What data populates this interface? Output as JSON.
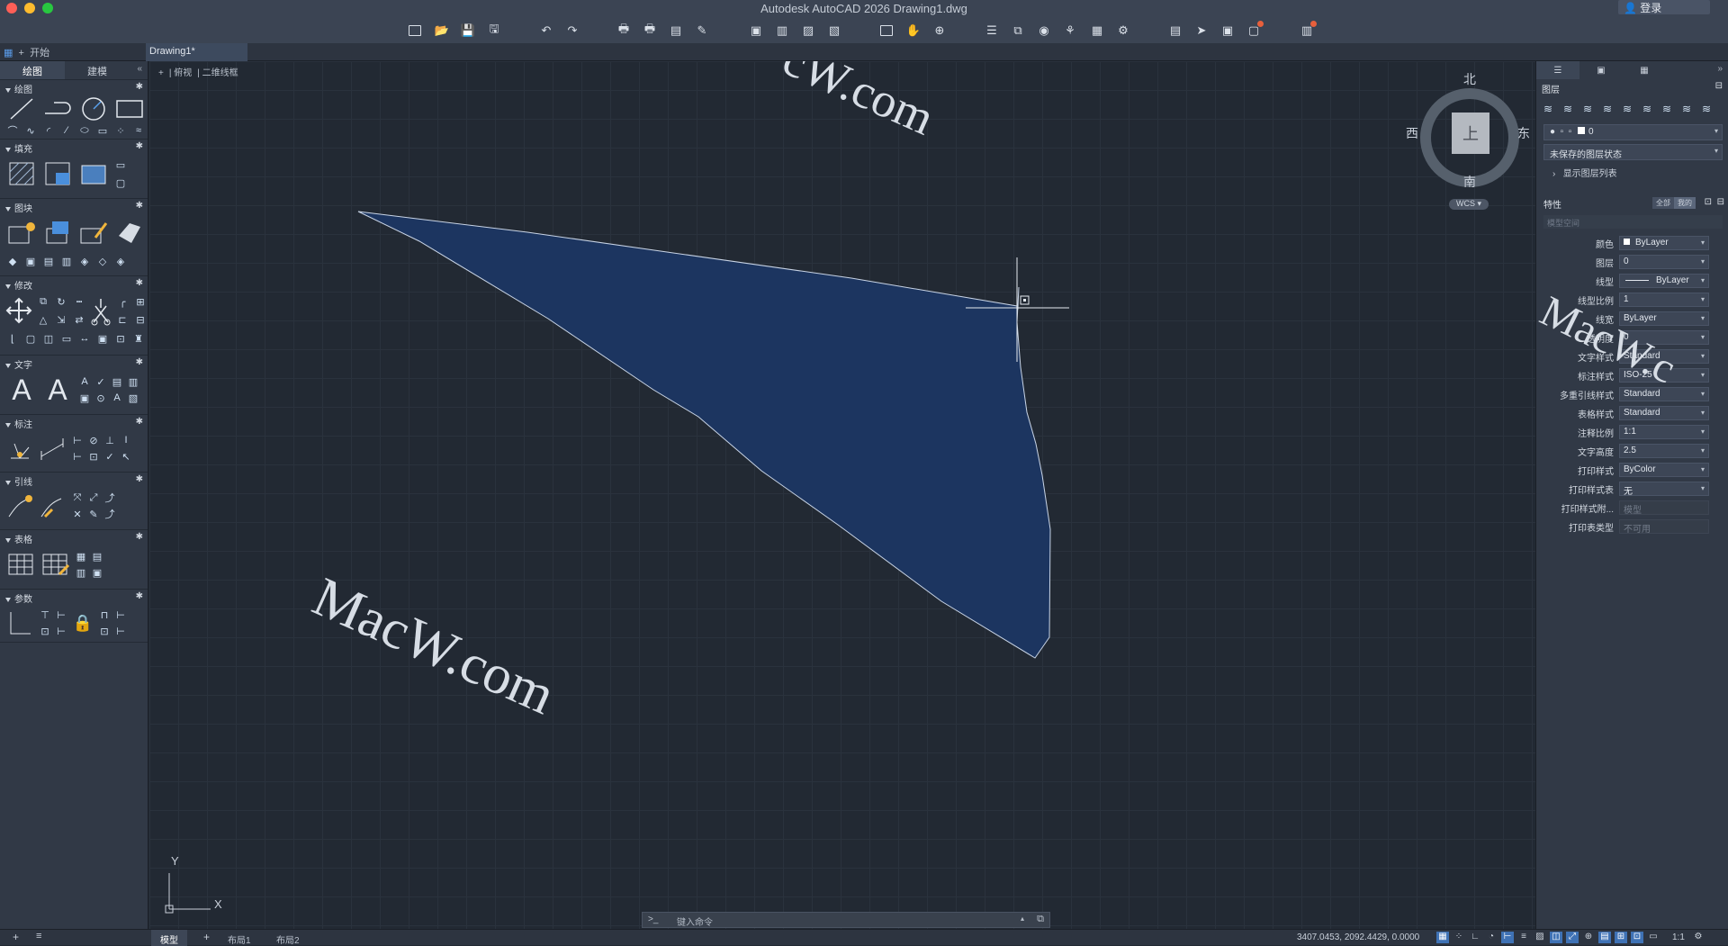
{
  "app": {
    "title": "Autodesk AutoCAD 2026    Drawing1.dwg",
    "login": "登录"
  },
  "tabs": {
    "start": "开始",
    "document": "Drawing1*"
  },
  "palette": {
    "tabs": [
      "绘图",
      "建模"
    ],
    "sections": [
      {
        "label": "绘图"
      },
      {
        "label": "填充"
      },
      {
        "label": "图块"
      },
      {
        "label": "修改"
      },
      {
        "label": "文字"
      },
      {
        "label": "标注"
      },
      {
        "label": "引线"
      },
      {
        "label": "表格"
      },
      {
        "label": "参数"
      }
    ]
  },
  "viewport": {
    "controls": [
      "+",
      "俯视",
      "二维线框"
    ],
    "navcube": {
      "top_face": "上",
      "north": "北",
      "south": "南",
      "east": "东",
      "west": "西",
      "wcs": "WCS"
    },
    "ucs": {
      "x": "X",
      "y": "Y"
    },
    "shape_fill": "#1c3560",
    "shape_stroke": "#c8d4e6"
  },
  "command": {
    "prompt": ">_",
    "placeholder": "键入命令"
  },
  "watermark": {
    "main": "MacW.com",
    "top": "cW.com",
    "right": "MacW.c"
  },
  "layers": {
    "title": "图层",
    "current_layer": "0",
    "state": "未保存的图层状态",
    "show_list": "显示图层列表"
  },
  "properties": {
    "title": "特性",
    "filter": [
      "全部",
      "我的"
    ],
    "space": "模型空间",
    "rows": [
      {
        "label": "颜色",
        "value": "ByLayer",
        "swatch": true
      },
      {
        "label": "图层",
        "value": "0"
      },
      {
        "label": "线型",
        "value": "ByLayer",
        "line": true
      },
      {
        "label": "线型比例",
        "value": "1"
      },
      {
        "label": "线宽",
        "value": "ByLayer"
      },
      {
        "label": "透明度",
        "value": "0"
      },
      {
        "label": "文字样式",
        "value": "Standard"
      },
      {
        "label": "标注样式",
        "value": "ISO-25"
      },
      {
        "label": "多重引线样式",
        "value": "Standard"
      },
      {
        "label": "表格样式",
        "value": "Standard"
      },
      {
        "label": "注释比例",
        "value": "1:1"
      },
      {
        "label": "文字高度",
        "value": "2.5"
      },
      {
        "label": "打印样式",
        "value": "ByColor"
      },
      {
        "label": "打印样式表",
        "value": "无"
      },
      {
        "label": "打印样式附...",
        "value": "模型",
        "disabled": true
      },
      {
        "label": "打印表类型",
        "value": "不可用",
        "disabled": true
      }
    ]
  },
  "status": {
    "layouts": [
      "模型",
      "布局1",
      "布局2"
    ],
    "coordinates": "3407.0453, 2092.4429, 0.0000",
    "scale": "1:1"
  }
}
